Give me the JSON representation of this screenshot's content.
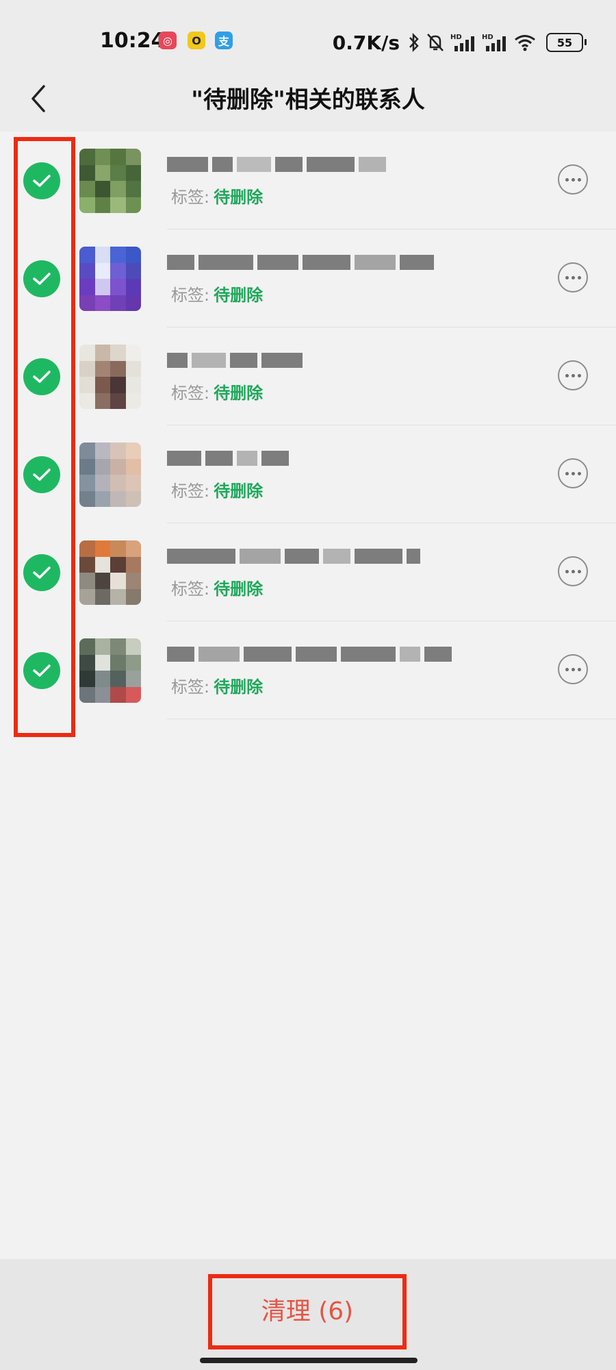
{
  "status_bar": {
    "time": "10:24",
    "network_speed": "0.7K/s",
    "battery": "55",
    "app_icons": [
      {
        "name": "netease-music-icon",
        "color": "#e8485a",
        "glyph": "◎"
      },
      {
        "name": "app-yellow-icon",
        "color": "#f2c81a",
        "glyph": "O"
      },
      {
        "name": "alipay-icon",
        "color": "#2f9fe8",
        "glyph": "支"
      }
    ]
  },
  "header": {
    "back_icon": "chevron-left-icon",
    "title": "\"待删除\"相关的联系人"
  },
  "contacts": [
    {
      "tag_key": "标签:",
      "tag_value": "待删除",
      "checked": true
    },
    {
      "tag_key": "标签:",
      "tag_value": "待删除",
      "checked": true
    },
    {
      "tag_key": "标签:",
      "tag_value": "待删除",
      "checked": true
    },
    {
      "tag_key": "标签:",
      "tag_value": "待删除",
      "checked": true
    },
    {
      "tag_key": "标签:",
      "tag_value": "待删除",
      "checked": true
    },
    {
      "tag_key": "标签:",
      "tag_value": "待删除",
      "checked": true
    }
  ],
  "colors": {
    "check_green": "#1fb862",
    "tag_green": "#1fa85a",
    "action_red": "#e65444",
    "annotation_red": "#ee2a12"
  },
  "footer": {
    "clean_label": "清理 (6)"
  }
}
